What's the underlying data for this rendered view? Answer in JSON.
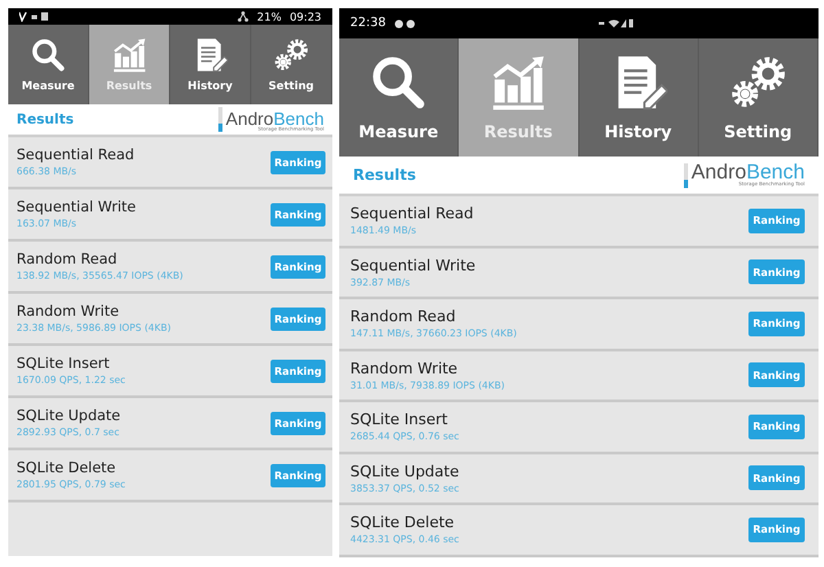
{
  "screens": [
    {
      "kind": "small",
      "status_bar": {
        "kind": "clock-right",
        "battery": "21%",
        "time": "09:23"
      },
      "tabs": [
        {
          "kind": "search",
          "label": "Measure",
          "selected": false
        },
        {
          "kind": "chart",
          "label": "Results",
          "selected": true
        },
        {
          "kind": "document",
          "label": "History",
          "selected": false
        },
        {
          "kind": "gears",
          "label": "Setting",
          "selected": false
        }
      ],
      "header": {
        "title": "Results",
        "logo": {
          "part_a": "Andro",
          "part_b": "Bench",
          "tagline": "Storage Benchmarking Tool"
        }
      },
      "results": [
        {
          "name": "Sequential Read",
          "value": "666.38 MB/s",
          "button": "Ranking"
        },
        {
          "name": "Sequential Write",
          "value": "163.07 MB/s",
          "button": "Ranking"
        },
        {
          "name": "Random Read",
          "value": "138.92 MB/s, 35565.47 IOPS (4KB)",
          "button": "Ranking"
        },
        {
          "name": "Random Write",
          "value": "23.38 MB/s, 5986.89 IOPS (4KB)",
          "button": "Ranking"
        },
        {
          "name": "SQLite Insert",
          "value": "1670.09 QPS, 1.22 sec",
          "button": "Ranking"
        },
        {
          "name": "SQLite Update",
          "value": "2892.93 QPS, 0.7 sec",
          "button": "Ranking"
        },
        {
          "name": "SQLite Delete",
          "value": "2801.95 QPS, 0.79 sec",
          "button": "Ranking"
        }
      ]
    },
    {
      "kind": "large",
      "status_bar": {
        "kind": "clock-left",
        "time": "22:38"
      },
      "tabs": [
        {
          "kind": "search",
          "label": "Measure",
          "selected": false
        },
        {
          "kind": "chart",
          "label": "Results",
          "selected": true
        },
        {
          "kind": "document",
          "label": "History",
          "selected": false
        },
        {
          "kind": "gears",
          "label": "Setting",
          "selected": false
        }
      ],
      "header": {
        "title": "Results",
        "logo": {
          "part_a": "Andro",
          "part_b": "Bench",
          "tagline": "Storage Benchmarking Tool"
        }
      },
      "results": [
        {
          "name": "Sequential Read",
          "value": "1481.49 MB/s",
          "button": "Ranking"
        },
        {
          "name": "Sequential Write",
          "value": "392.87 MB/s",
          "button": "Ranking"
        },
        {
          "name": "Random Read",
          "value": "147.11 MB/s, 37660.23 IOPS (4KB)",
          "button": "Ranking"
        },
        {
          "name": "Random Write",
          "value": "31.01 MB/s, 7938.89 IOPS (4KB)",
          "button": "Ranking"
        },
        {
          "name": "SQLite Insert",
          "value": "2685.44 QPS, 0.76 sec",
          "button": "Ranking"
        },
        {
          "name": "SQLite Update",
          "value": "3853.37 QPS, 0.52 sec",
          "button": "Ranking"
        },
        {
          "name": "SQLite Delete",
          "value": "4423.31 QPS, 0.46 sec",
          "button": "Ranking"
        }
      ]
    }
  ]
}
